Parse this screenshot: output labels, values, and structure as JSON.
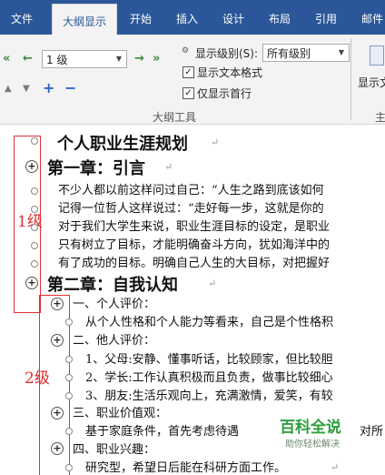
{
  "ribbon": {
    "tabs": [
      "文件",
      "大纲显示",
      "开始",
      "插入",
      "设计",
      "布局",
      "引用",
      "邮件"
    ],
    "active_tab": "大纲显示",
    "level_value": "1 级",
    "show_level_label": "显示级别(S):",
    "show_level_value": "所有级别",
    "show_text_format": "显示文本格式",
    "show_first_line_only": "仅显示首行",
    "group_label": "大纲工具",
    "partial_right_label": "显示文",
    "partial_right_group": "主"
  },
  "document": {
    "title": "个人职业生涯规划",
    "chapter1": "第一章：引言",
    "para1": "不少人都以前这样问过自己：“人生之路到底该如何",
    "para2": "记得一位哲人这样说过：“走好每一步，这就是你的",
    "para3": "对于我们大学生来说，职业生涯目标的设定，是职业",
    "para4": "只有树立了目标，才能明确奋斗方向，犹如海洋中的",
    "para5": "有了成功的目标。明确自己人生的大目标，对把握好",
    "chapter2": "第二章：自我认知",
    "s1": "一、个人评价：",
    "s1p": "从个人性格和个人能力等看来，自己是个性格积",
    "s2": "二、他人评价：",
    "s2a": "1、父母:安静、懂事听话，比较顾家，但比较胆",
    "s2b": "2、学长:工作认真积极而且负责，做事比较细心",
    "s2c": "3、朋友:生活乐观向上，充满激情，爱笑，有较",
    "s3": "三、职业价值观：",
    "s3p": "基于家庭条件，首先考虑待遇",
    "s3p_tail": "对所",
    "s4": "四、职业兴趣：",
    "s4p": "研究型，希望日后能在科研方面工作。"
  },
  "annotations": {
    "level1": "1级",
    "level2": "2级"
  },
  "watermark": {
    "title": "百科全说",
    "subtitle": "助你轻松解决"
  },
  "colors": {
    "ribbon_blue": "#2b579a",
    "annotation_red": "#e03030",
    "watermark_green": "#2e9e3e"
  }
}
